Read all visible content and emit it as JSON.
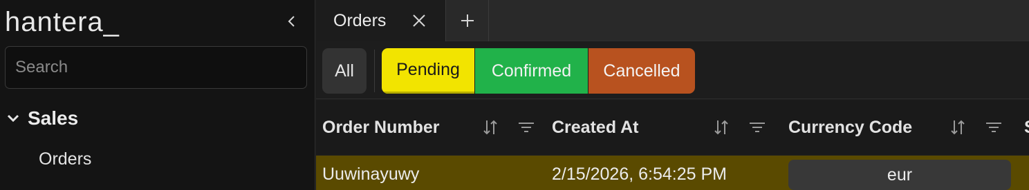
{
  "sidebar": {
    "logo": "hantera_",
    "search_placeholder": "Search",
    "section": {
      "label": "Sales"
    },
    "items": [
      {
        "label": "Orders"
      }
    ]
  },
  "tabs": [
    {
      "label": "Orders"
    }
  ],
  "filters": {
    "all": "All",
    "statuses": [
      {
        "label": "Pending",
        "color": "#f2e400"
      },
      {
        "label": "Confirmed",
        "color": "#21b24a"
      },
      {
        "label": "Cancelled",
        "color": "#b8521f"
      }
    ]
  },
  "table": {
    "columns": [
      {
        "label": "Order Number"
      },
      {
        "label": "Created At"
      },
      {
        "label": "Currency Code"
      },
      {
        "label": "S"
      }
    ],
    "rows": [
      {
        "order_number": "Uuwinayuwy",
        "created_at": "2/15/2026, 6:54:25 PM",
        "currency_code": "eur"
      }
    ]
  },
  "colors": {
    "selected_row": "#5a4a00",
    "sidebar_bg": "#141414"
  }
}
